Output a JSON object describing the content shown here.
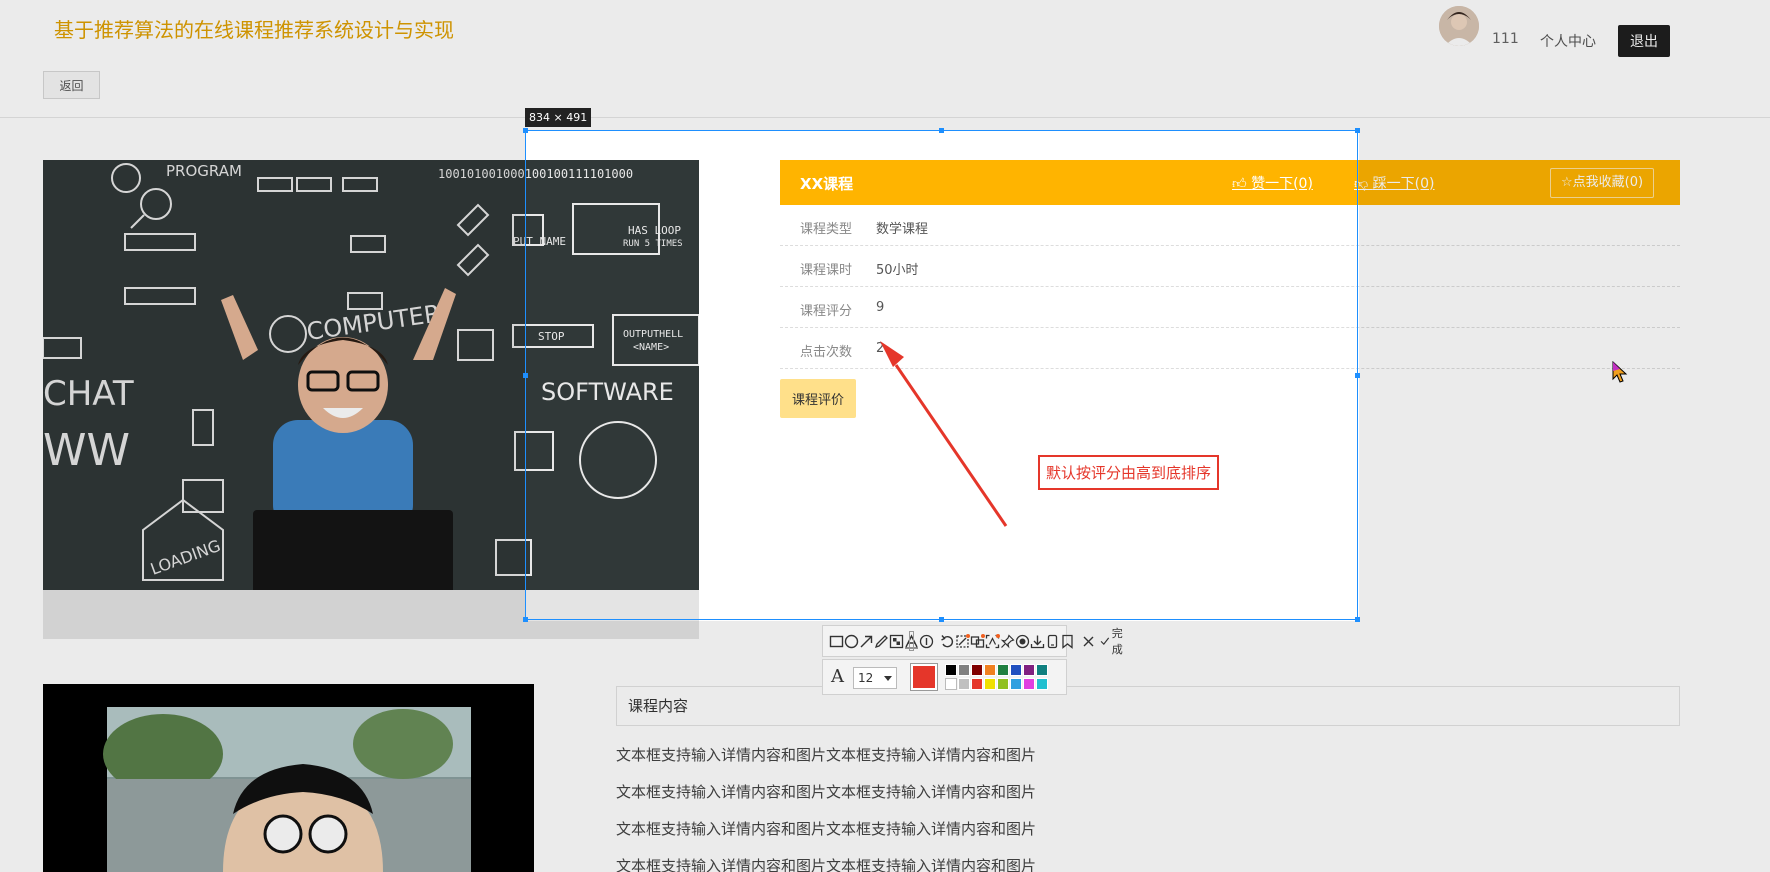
{
  "header": {
    "site_title": "基于推荐算法的在线课程推荐系统设计与实现",
    "username": "111",
    "center_link": "个人中心",
    "logout_label": "退出",
    "back_label": "返回"
  },
  "course": {
    "name": "XX课程",
    "like_label": "赞一下(0)",
    "dislike_label": "踩一下(0)",
    "favorite_label": "点我收藏(0)",
    "fields": [
      {
        "label": "课程类型",
        "value": "数学课程"
      },
      {
        "label": "课程课时",
        "value": "50小时"
      },
      {
        "label": "课程评分",
        "value": "9"
      },
      {
        "label": "点击次数",
        "value": "2"
      }
    ],
    "review_label": "课程评价",
    "image_texts": {
      "program": "PROGRAM",
      "computer": "COMPUTER",
      "chat": "CHAT",
      "www": "WW",
      "loading": "LOADING",
      "software": "SOFTWARE",
      "input_name": "PUT NAME",
      "has_loop": "HAS LOOP",
      "run_times": "RUN 5 TIMES",
      "stop": "STOP",
      "output": "OUTPUTHELL",
      "name_tag": "<NAME>",
      "binary": "100101001000100100111101000"
    }
  },
  "content": {
    "title": "课程内容",
    "lines": [
      "文本框支持输入详情内容和图片文本框支持输入详情内容和图片",
      "文本框支持输入详情内容和图片文本框支持输入详情内容和图片",
      "文本框支持输入详情内容和图片文本框支持输入详情内容和图片",
      "文本框支持输入详情内容和图片文本框支持输入详情内容和图片"
    ]
  },
  "capture": {
    "size_label": "834 × 491",
    "annotation": "默认按评分由高到底排序",
    "done_label": "完成",
    "font_size": "12",
    "current_color": "#e5362a",
    "palette_top": [
      "#000000",
      "#808080",
      "#800000",
      "#f08020",
      "#208040",
      "#2050c0",
      "#802080",
      "#108080"
    ],
    "palette_bottom": [
      "#ffffff",
      "#c0c0c0",
      "#e5362a",
      "#f0e000",
      "#90c020",
      "#30a0e0",
      "#e040e0",
      "#20c0d0"
    ],
    "tools": [
      "rectangle-icon",
      "ellipse-icon",
      "arrow-icon",
      "pen-icon",
      "mosaic-icon",
      "text-icon",
      "number-icon",
      "undo-icon",
      "scroll-capture-icon",
      "translate-icon",
      "ocr-icon",
      "pin-icon",
      "record-icon",
      "download-icon",
      "phone-icon",
      "bookmark-icon",
      "close-icon",
      "check-icon"
    ]
  }
}
